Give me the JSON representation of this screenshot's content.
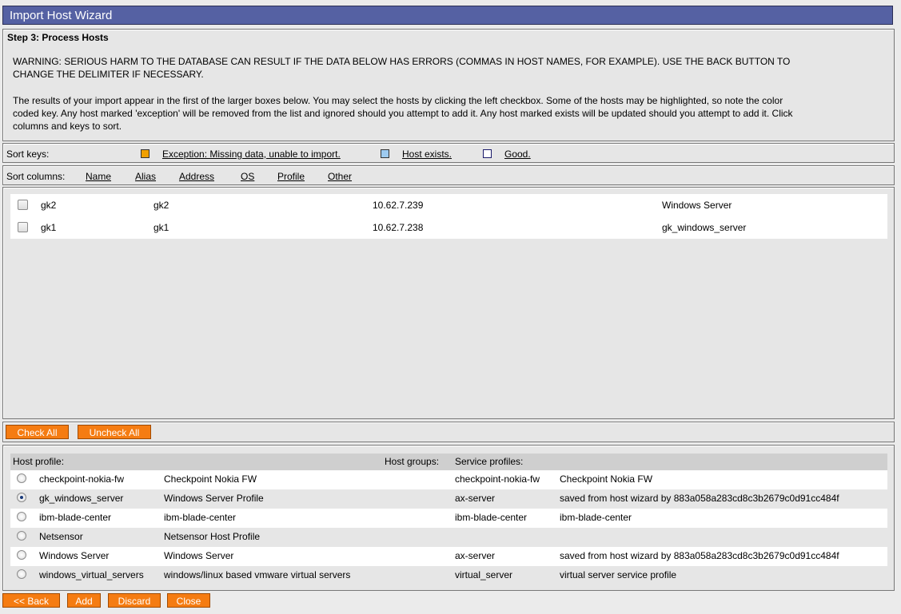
{
  "window": {
    "title": "Import Host Wizard"
  },
  "step": {
    "title": "Step 3: Process Hosts",
    "warning_line1": "WARNING: SERIOUS HARM TO THE DATABASE CAN RESULT IF THE DATA BELOW HAS ERRORS (COMMAS IN HOST NAMES, FOR EXAMPLE). USE THE BACK BUTTON TO",
    "warning_line2": "CHANGE THE DELIMITER IF NECESSARY.",
    "info_line1": "The results of your import appear in the first of the larger boxes below. You may select the hosts by clicking the left checkbox. Some of the hosts may be highlighted, so note the color",
    "info_line2": "coded key. Any host marked 'exception' will be removed from the list and ignored should you attempt to add it. Any host marked exists will be updated should you attempt to add it. Click",
    "info_line3": "columns and keys to sort."
  },
  "sort_keys": {
    "label": "Sort keys:",
    "keys": [
      {
        "label": "Exception: Missing data, unable to import.",
        "color": "#f0a000"
      },
      {
        "label": "Host exists.",
        "color": "#9ecbf0"
      },
      {
        "label": "Good.",
        "color": "#ffffff"
      }
    ]
  },
  "sort_columns": {
    "label": "Sort columns:",
    "columns": [
      "Name",
      "Alias",
      "Address",
      "OS",
      "Profile",
      "Other"
    ]
  },
  "hosts": [
    {
      "name": "gk2",
      "alias": "gk2",
      "address": "10.62.7.239",
      "profile": "Windows Server",
      "checked": false
    },
    {
      "name": "gk1",
      "alias": "gk1",
      "address": "10.62.7.238",
      "profile": "gk_windows_server",
      "checked": false
    }
  ],
  "buttons": {
    "check_all": "Check All",
    "uncheck_all": "Uncheck All",
    "back": "<< Back",
    "add": "Add",
    "discard": "Discard",
    "close": "Close"
  },
  "profiles": {
    "headers": {
      "host_profile": "Host profile:",
      "host_groups": "Host groups:",
      "service_profiles": "Service profiles:"
    },
    "rows": [
      {
        "name": "checkpoint-nokia-fw",
        "desc": "Checkpoint Nokia FW",
        "service": "checkpoint-nokia-fw",
        "service_desc": "Checkpoint Nokia FW",
        "selected": false
      },
      {
        "name": "gk_windows_server",
        "desc": "Windows Server Profile",
        "service": "ax-server",
        "service_desc": "saved from host wizard by 883a058a283cd8c3b2679c0d91cc484f",
        "selected": true
      },
      {
        "name": "ibm-blade-center",
        "desc": "ibm-blade-center",
        "service": "ibm-blade-center",
        "service_desc": "ibm-blade-center",
        "selected": false
      },
      {
        "name": "Netsensor",
        "desc": "Netsensor Host Profile",
        "service": "",
        "service_desc": "",
        "selected": false
      },
      {
        "name": "Windows Server",
        "desc": "Windows Server",
        "service": "ax-server",
        "service_desc": "saved from host wizard by 883a058a283cd8c3b2679c0d91cc484f",
        "selected": false
      },
      {
        "name": "windows_virtual_servers",
        "desc": "windows/linux based vmware virtual servers",
        "service": "virtual_server",
        "service_desc": "virtual server service profile",
        "selected": false
      }
    ]
  }
}
